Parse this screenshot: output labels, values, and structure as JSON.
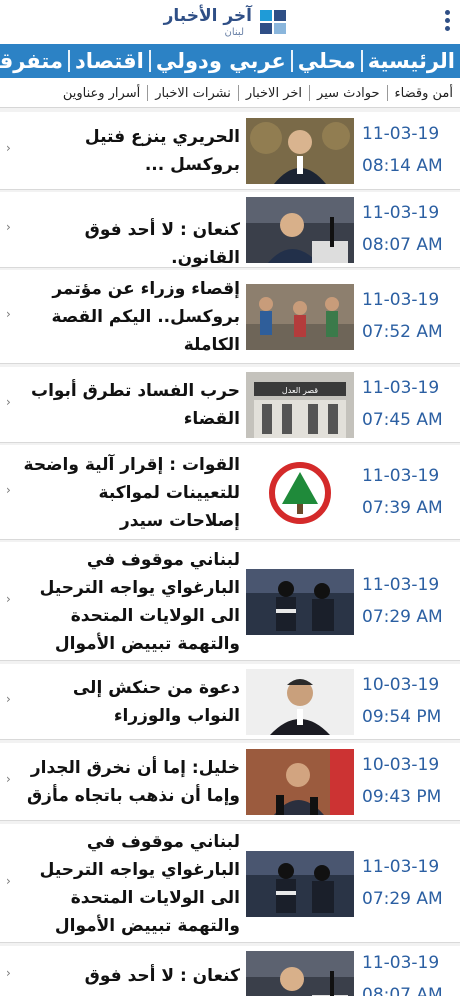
{
  "header": {
    "logo_title": "آخر الأخبار",
    "logo_subtitle": "لبنان",
    "menu_icon": "kebab-menu-icon"
  },
  "nav": {
    "items": [
      "الرئيسية",
      "محلي",
      "عربي ودولي",
      "اقتصاد",
      "متفرقات"
    ]
  },
  "subnav": {
    "items": [
      "أمن وقضاء",
      "حوادث سير",
      "اخر الاخبار",
      "نشرات الاخبار",
      "أسرار وعناوين"
    ]
  },
  "colors": {
    "nav_bg": "#2c82c5",
    "date_text": "#2b5fa2",
    "logo": "#2f4f86"
  },
  "articles": [
    {
      "title": "الحريري ينزع فتيل بروكسل ...",
      "date": "11-03-19",
      "time": "08:14 AM",
      "thumb": "man-speaking-photo"
    },
    {
      "title": "كنعان : لا أحد فوق القانون.",
      "date": "11-03-19",
      "time": "08:07 AM",
      "thumb": "press-conference-photo"
    },
    {
      "title": "إقصاء وزراء عن مؤتمر بروكسل.. اليكم القصة الكاملة",
      "date": "11-03-19",
      "time": "07:52 AM",
      "thumb": "refugees-photo"
    },
    {
      "title": "حرب الفساد تطرق أبواب القضاء",
      "date": "11-03-19",
      "time": "07:45 AM",
      "thumb": "justice-palace-photo"
    },
    {
      "title": "القوات : إقرار آلية واضحة للتعيينات لمواكبة إصلاحات سيدر",
      "date": "11-03-19",
      "time": "07:39 AM",
      "thumb": "cedar-logo-photo"
    },
    {
      "title": "لبناني موقوف في البارغواي يواجه الترحيل الى الولايات المتحدة والتهمة تبييض الأموال لصالح حزب الله",
      "date": "11-03-19",
      "time": "07:29 AM",
      "thumb": "police-photo"
    },
    {
      "title": "دعوة من حنكش إلى النواب والوزراء",
      "date": "10-03-19",
      "time": "09:54 PM",
      "thumb": "portrait-photo"
    },
    {
      "title": "خليل: إما أن نخرق الجدار وإما أن نذهب باتجاه مأزق",
      "date": "10-03-19",
      "time": "09:43 PM",
      "thumb": "minister-photo"
    },
    {
      "title": "لبناني موقوف في البارغواي يواجه الترحيل الى الولايات المتحدة والتهمة تبييض الأموال لصالح حزب الله",
      "date": "11-03-19",
      "time": "07:29 AM",
      "thumb": "police-photo"
    },
    {
      "title": "كنعان : لا أحد فوق القانون.",
      "date": "11-03-19",
      "time": "08:07 AM",
      "thumb": "press-conference-photo"
    }
  ]
}
